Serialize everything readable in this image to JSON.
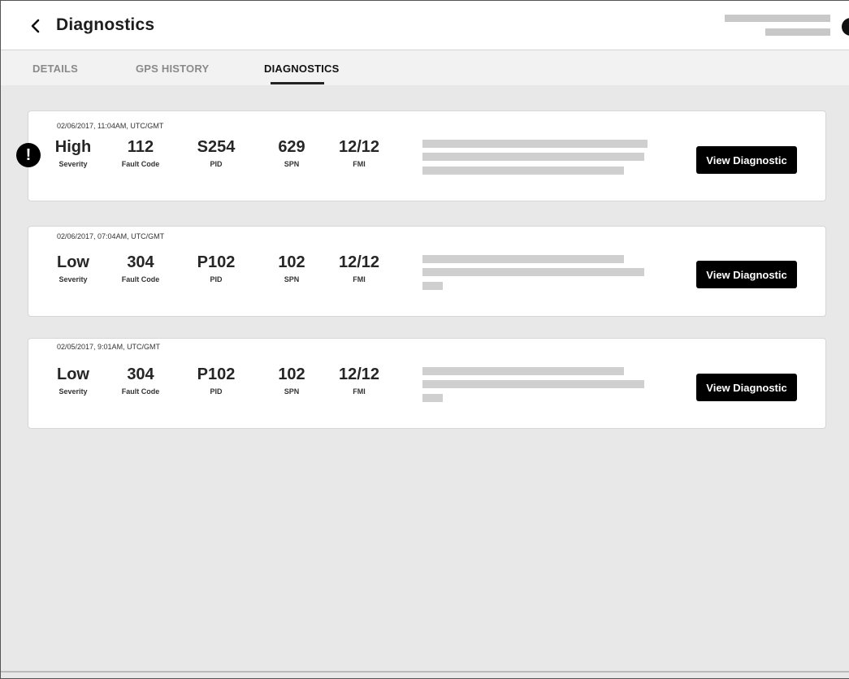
{
  "header": {
    "title": "Diagnostics",
    "back_icon": "chevron-left-icon",
    "avatar_icon": "avatar-icon"
  },
  "tabs": [
    {
      "label": "DETAILS",
      "active": false
    },
    {
      "label": "GPS HISTORY",
      "active": false
    },
    {
      "label": "DIAGNOSTICS",
      "active": true
    }
  ],
  "labels": {
    "severity": "Severity",
    "fault_code": "Fault Code",
    "pid": "PID",
    "spn": "SPN",
    "fmi": "FMI"
  },
  "diagnostics": [
    {
      "timestamp": "02/06/2017, 11:04AM, UTC/GMT",
      "severity": "High",
      "fault_code": "112",
      "pid": "S254",
      "spn": "629",
      "fmi": "12/12",
      "alert": true,
      "button_label": "View Diagnostic"
    },
    {
      "timestamp": "02/06/2017, 07:04AM, UTC/GMT",
      "severity": "Low",
      "fault_code": "304",
      "pid": "P102",
      "spn": "102",
      "fmi": "12/12",
      "alert": false,
      "button_label": "View Diagnostic"
    },
    {
      "timestamp": "02/05/2017, 9:01AM, UTC/GMT",
      "severity": "Low",
      "fault_code": "304",
      "pid": "P102",
      "spn": "102",
      "fmi": "12/12",
      "alert": false,
      "button_label": "View Diagnostic"
    }
  ],
  "alert_icon": {
    "name": "alert-icon",
    "glyph": "!"
  },
  "colors": {
    "background": "#e8e8e8",
    "card": "#ffffff",
    "button": "#000000",
    "placeholder_bar": "#cfcfcf",
    "active_tab": "#111111",
    "inactive_tab": "#8a8a8a"
  }
}
